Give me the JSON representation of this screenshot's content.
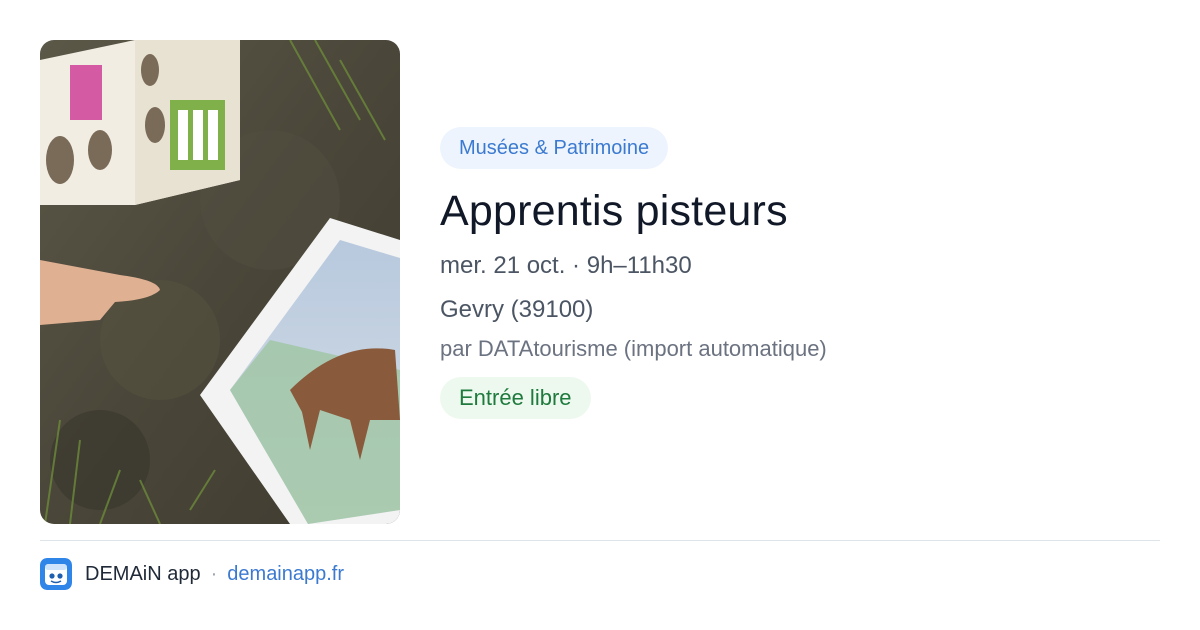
{
  "event": {
    "category": "Musées & Patrimoine",
    "title": "Apprentis pisteurs",
    "date_time": "mer. 21 oct. · 9h–11h30",
    "location": "Gevry (39100)",
    "author": "par DATAtourisme (import automatique)",
    "price": "Entrée libre",
    "image_icon": "event-photo-animal-tracks"
  },
  "footer": {
    "app_name": "DEMAiN app",
    "separator": "·",
    "url": "demainapp.fr",
    "logo_icon": "demain-app-logo"
  },
  "colors": {
    "category_bg": "#eef4fd",
    "category_text": "#3b7ad0",
    "price_bg": "#edf9ef",
    "price_text": "#1f7a3d",
    "link": "#3b7ad0",
    "title": "#111827"
  }
}
